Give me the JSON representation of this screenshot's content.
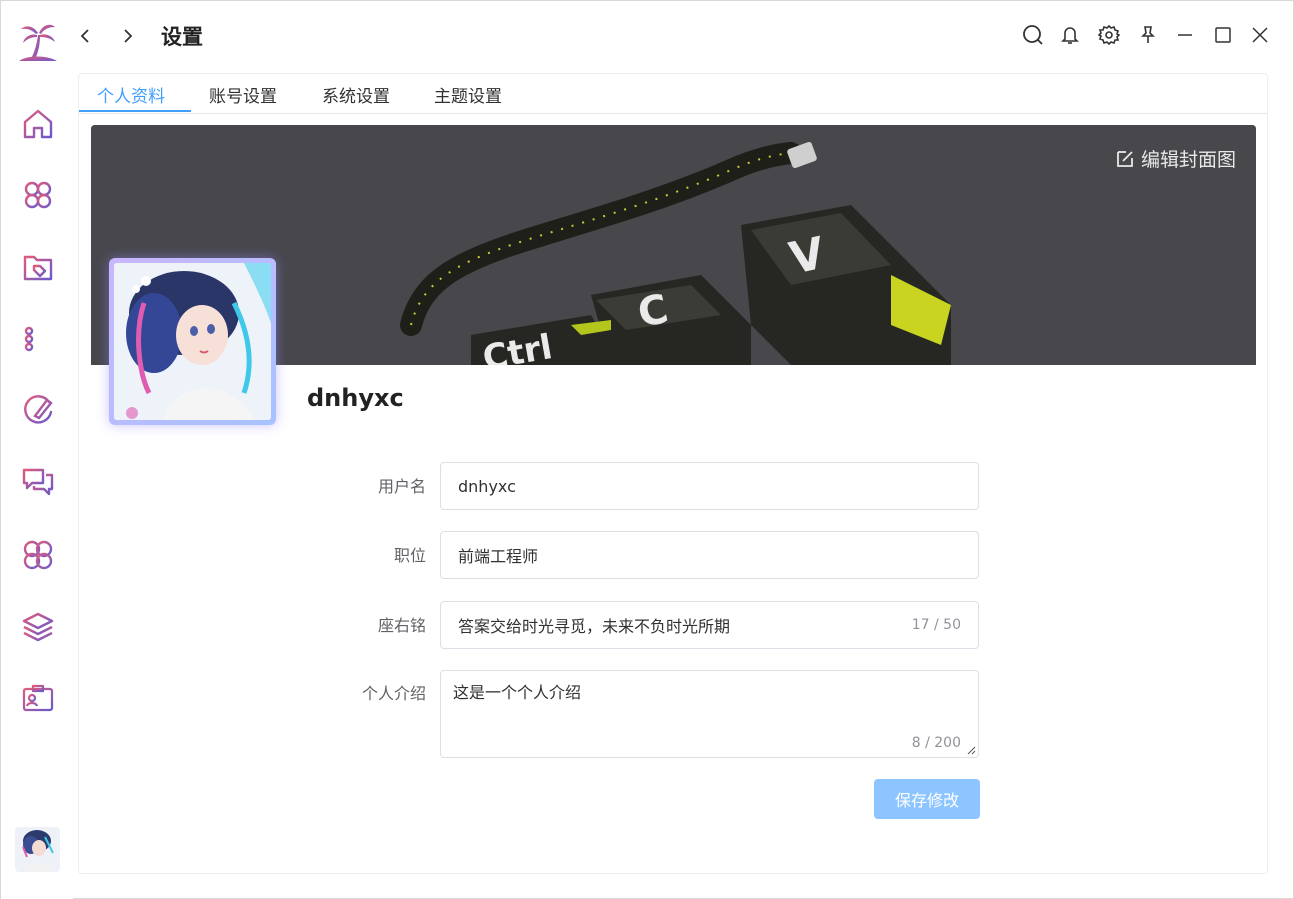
{
  "app": {
    "title": "设置"
  },
  "sidebar": {
    "items": [
      {
        "name": "home",
        "icon": "home-icon"
      },
      {
        "name": "apps",
        "icon": "apps-icon"
      },
      {
        "name": "folder-tag",
        "icon": "folder-tag-icon"
      },
      {
        "name": "list",
        "icon": "list-icon"
      },
      {
        "name": "brush",
        "icon": "brush-icon"
      },
      {
        "name": "chat",
        "icon": "chat-icon"
      },
      {
        "name": "pattern",
        "icon": "pattern-icon"
      },
      {
        "name": "layers",
        "icon": "layers-icon"
      },
      {
        "name": "contact-card",
        "icon": "contact-card-icon"
      }
    ]
  },
  "tabs": [
    {
      "label": "个人资料",
      "active": true
    },
    {
      "label": "账号设置",
      "active": false
    },
    {
      "label": "系统设置",
      "active": false
    },
    {
      "label": "主题设置",
      "active": false
    }
  ],
  "cover": {
    "edit_label": "编辑封面图"
  },
  "profile": {
    "name": "dnhyxc"
  },
  "form": {
    "username_label": "用户名",
    "username_value": "dnhyxc",
    "job_label": "职位",
    "job_value": "前端工程师",
    "motto_label": "座右铭",
    "motto_value": "答案交给时光寻觅，未来不负时光所期",
    "motto_counter": "17 / 50",
    "intro_label": "个人介绍",
    "intro_value": "这是一个个人介绍",
    "intro_counter": "8 / 200",
    "save_label": "保存修改"
  },
  "colors": {
    "accent": "#409eff",
    "save_button": "#8cc5ff",
    "icon_gradient_start": "#e25a7a",
    "icon_gradient_end": "#6a5acd"
  }
}
